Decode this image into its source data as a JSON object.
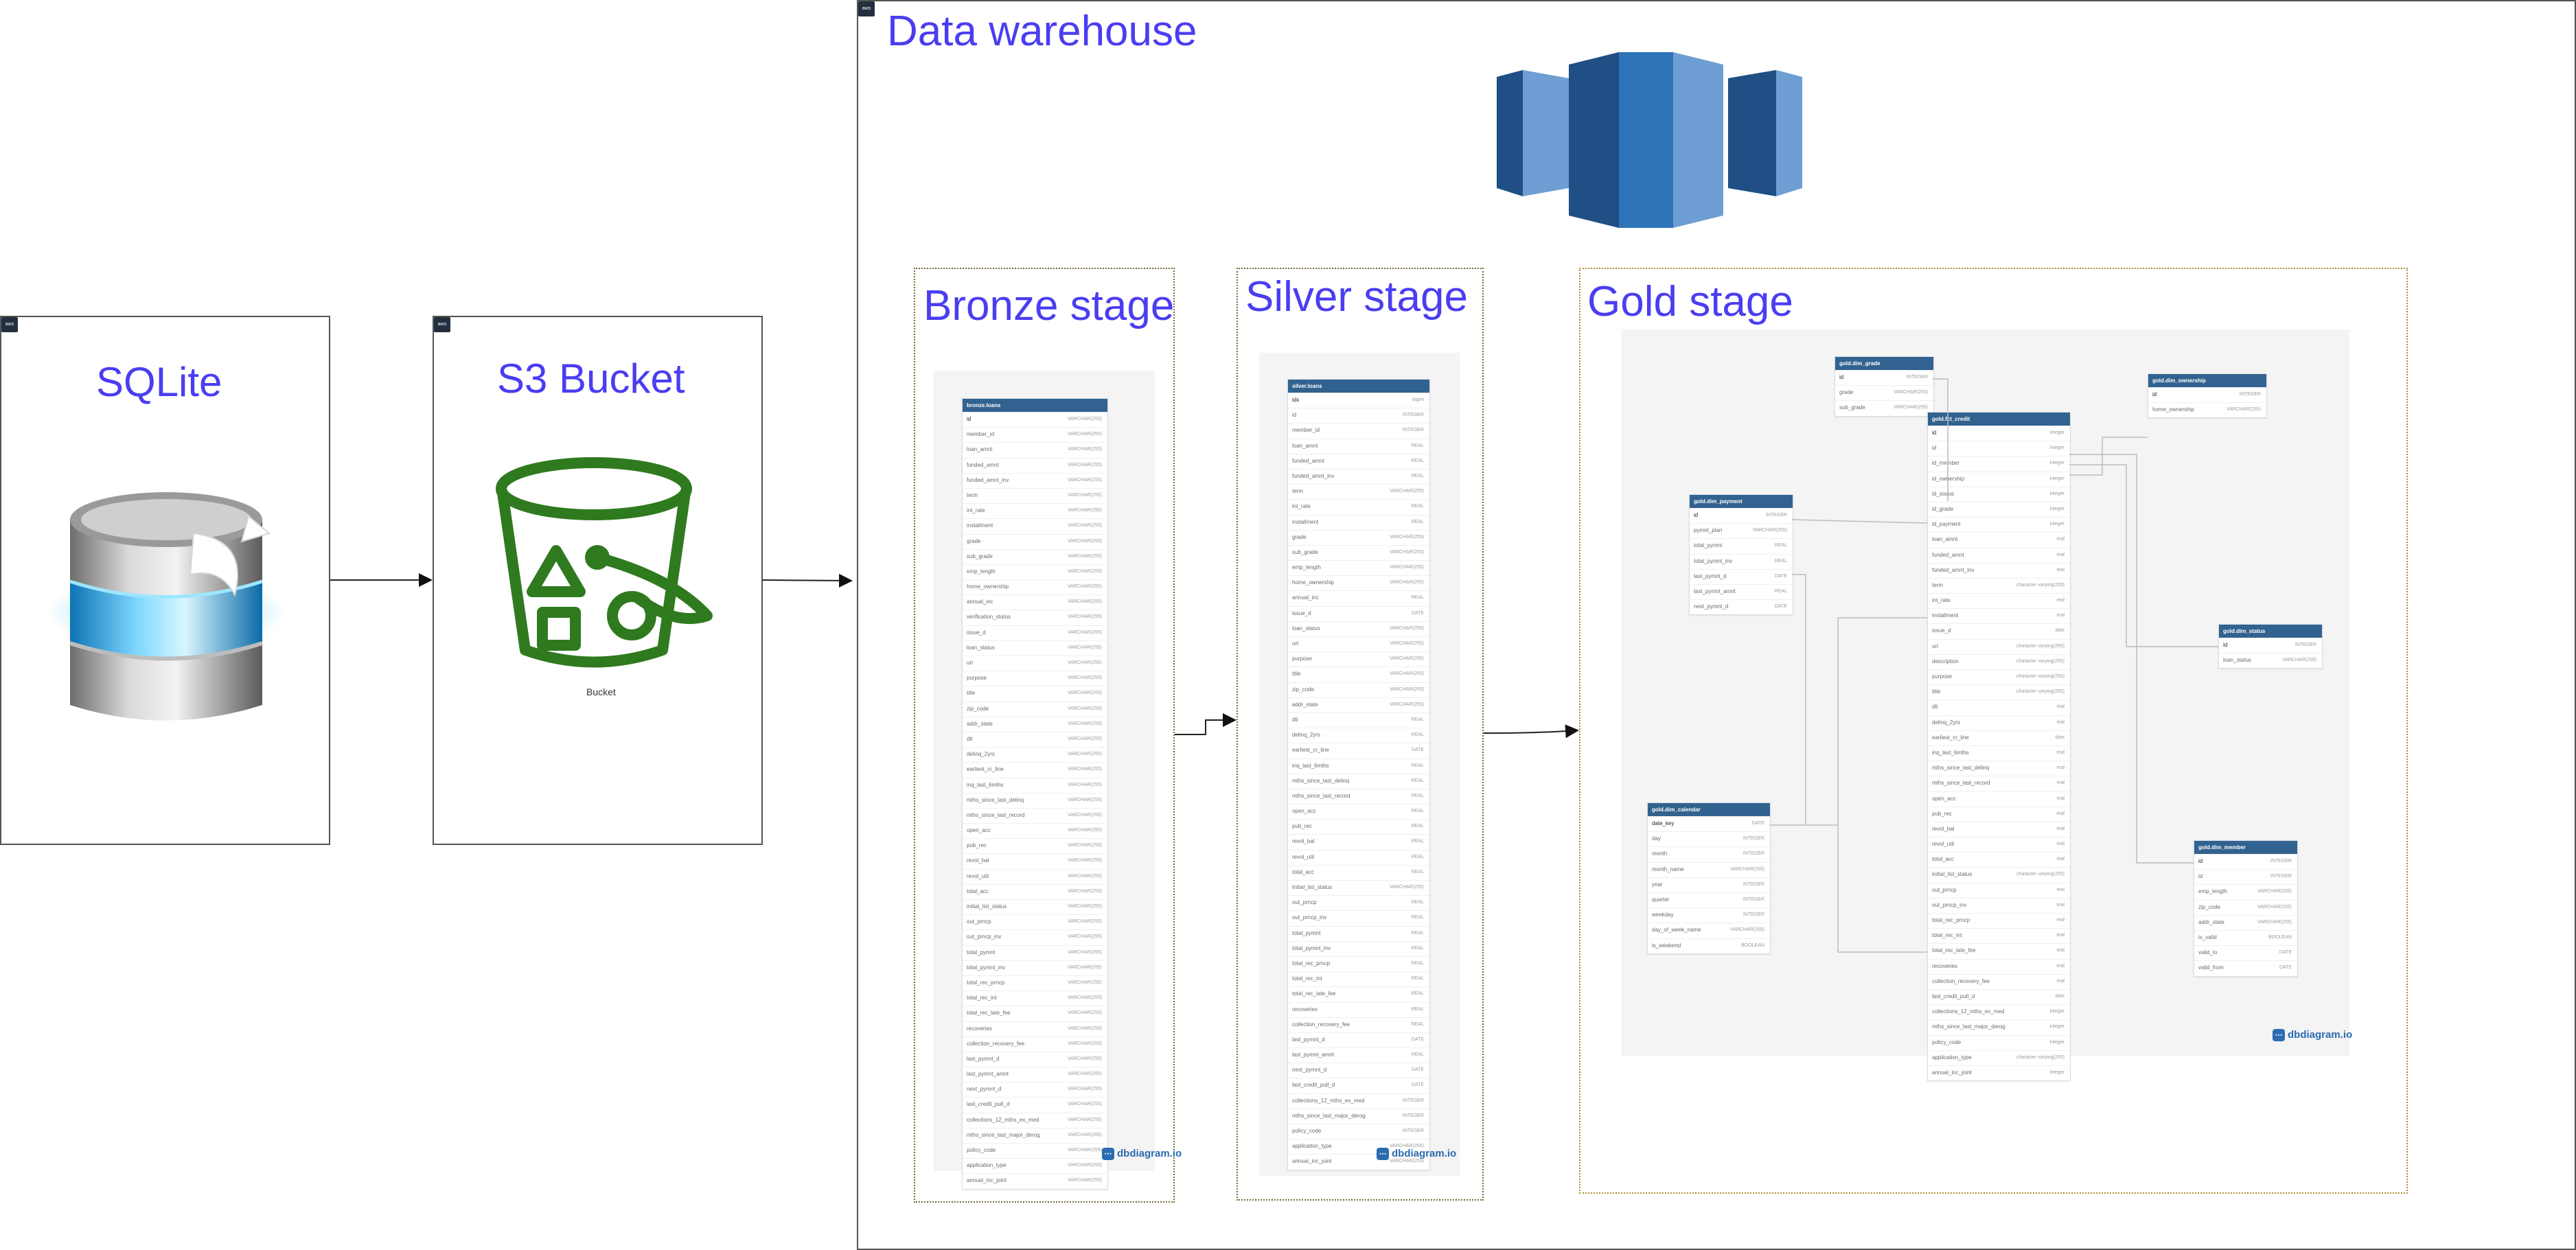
{
  "sqlite": {
    "title": "SQLite",
    "badge": "aws"
  },
  "s3": {
    "title": "S3 Bucket",
    "caption": "Bucket",
    "badge": "aws"
  },
  "warehouse": {
    "title": "Data warehouse",
    "badge": "aws"
  },
  "stages": {
    "bronze": "Bronze stage",
    "silver": "Silver stage",
    "gold": "Gold stage"
  },
  "dbdiagram_label": "dbdiagram.io",
  "icons": {
    "sqlite": "sqlite-database-icon",
    "s3": "s3-bucket-icon",
    "redshift": "amazon-redshift-icon",
    "dbdiagram": "dbdiagram-logo-icon"
  },
  "colors": {
    "title_blue": "#4a3df2",
    "bucket_green": "#2f7a1f",
    "table_header": "#32628f",
    "redshift_dark": "#1f4f84",
    "redshift_mid": "#2e73b8",
    "redshift_light": "#6e9ed3"
  },
  "bronze_table": {
    "name": "bronze.loans",
    "columns": [
      [
        "id",
        "VARCHAR(255)"
      ],
      [
        "member_id",
        "VARCHAR(255)"
      ],
      [
        "loan_amnt",
        "VARCHAR(255)"
      ],
      [
        "funded_amnt",
        "VARCHAR(255)"
      ],
      [
        "funded_amnt_inv",
        "VARCHAR(255)"
      ],
      [
        "term",
        "VARCHAR(255)"
      ],
      [
        "int_rate",
        "VARCHAR(255)"
      ],
      [
        "installment",
        "VARCHAR(255)"
      ],
      [
        "grade",
        "VARCHAR(255)"
      ],
      [
        "sub_grade",
        "VARCHAR(255)"
      ],
      [
        "emp_length",
        "VARCHAR(255)"
      ],
      [
        "home_ownership",
        "VARCHAR(255)"
      ],
      [
        "annual_inc",
        "VARCHAR(255)"
      ],
      [
        "verification_status",
        "VARCHAR(255)"
      ],
      [
        "issue_d",
        "VARCHAR(255)"
      ],
      [
        "loan_status",
        "VARCHAR(255)"
      ],
      [
        "url",
        "VARCHAR(255)"
      ],
      [
        "purpose",
        "VARCHAR(255)"
      ],
      [
        "title",
        "VARCHAR(255)"
      ],
      [
        "zip_code",
        "VARCHAR(255)"
      ],
      [
        "addr_state",
        "VARCHAR(255)"
      ],
      [
        "dti",
        "VARCHAR(255)"
      ],
      [
        "delinq_2yrs",
        "VARCHAR(255)"
      ],
      [
        "earliest_cr_line",
        "VARCHAR(255)"
      ],
      [
        "inq_last_6mths",
        "VARCHAR(255)"
      ],
      [
        "mths_since_last_delinq",
        "VARCHAR(255)"
      ],
      [
        "mths_since_last_record",
        "VARCHAR(255)"
      ],
      [
        "open_acc",
        "VARCHAR(255)"
      ],
      [
        "pub_rec",
        "VARCHAR(255)"
      ],
      [
        "revol_bal",
        "VARCHAR(255)"
      ],
      [
        "revol_util",
        "VARCHAR(255)"
      ],
      [
        "total_acc",
        "VARCHAR(255)"
      ],
      [
        "initial_list_status",
        "VARCHAR(255)"
      ],
      [
        "out_prncp",
        "VARCHAR(255)"
      ],
      [
        "out_prncp_inv",
        "VARCHAR(255)"
      ],
      [
        "total_pymnt",
        "VARCHAR(255)"
      ],
      [
        "total_pymnt_inv",
        "VARCHAR(255)"
      ],
      [
        "total_rec_prncp",
        "VARCHAR(255)"
      ],
      [
        "total_rec_int",
        "VARCHAR(255)"
      ],
      [
        "total_rec_late_fee",
        "VARCHAR(255)"
      ],
      [
        "recoveries",
        "VARCHAR(255)"
      ],
      [
        "collection_recovery_fee",
        "VARCHAR(255)"
      ],
      [
        "last_pymnt_d",
        "VARCHAR(255)"
      ],
      [
        "last_pymnt_amnt",
        "VARCHAR(255)"
      ],
      [
        "next_pymnt_d",
        "VARCHAR(255)"
      ],
      [
        "last_credit_pull_d",
        "VARCHAR(255)"
      ],
      [
        "collections_12_mths_ex_med",
        "VARCHAR(255)"
      ],
      [
        "mths_since_last_major_derog",
        "VARCHAR(255)"
      ],
      [
        "policy_code",
        "VARCHAR(255)"
      ],
      [
        "application_type",
        "VARCHAR(255)"
      ],
      [
        "annual_inc_joint",
        "VARCHAR(255)"
      ]
    ]
  },
  "silver_table": {
    "name": "silver.loans",
    "columns": [
      [
        "idx",
        "bigint"
      ],
      [
        "id",
        "INTEGER"
      ],
      [
        "member_id",
        "INTEGER"
      ],
      [
        "loan_amnt",
        "REAL"
      ],
      [
        "funded_amnt",
        "REAL"
      ],
      [
        "funded_amnt_inv",
        "REAL"
      ],
      [
        "term",
        "VARCHAR(255)"
      ],
      [
        "int_rate",
        "REAL"
      ],
      [
        "installment",
        "REAL"
      ],
      [
        "grade",
        "VARCHAR(255)"
      ],
      [
        "sub_grade",
        "VARCHAR(255)"
      ],
      [
        "emp_length",
        "VARCHAR(255)"
      ],
      [
        "home_ownership",
        "VARCHAR(255)"
      ],
      [
        "annual_inc",
        "REAL"
      ],
      [
        "issue_d",
        "DATE"
      ],
      [
        "loan_status",
        "VARCHAR(255)"
      ],
      [
        "url",
        "VARCHAR(255)"
      ],
      [
        "purpose",
        "VARCHAR(255)"
      ],
      [
        "title",
        "VARCHAR(255)"
      ],
      [
        "zip_code",
        "VARCHAR(255)"
      ],
      [
        "addr_state",
        "VARCHAR(255)"
      ],
      [
        "dti",
        "REAL"
      ],
      [
        "delinq_2yrs",
        "REAL"
      ],
      [
        "earliest_cr_line",
        "DATE"
      ],
      [
        "inq_last_6mths",
        "REAL"
      ],
      [
        "mths_since_last_delinq",
        "REAL"
      ],
      [
        "mths_since_last_record",
        "REAL"
      ],
      [
        "open_acc",
        "REAL"
      ],
      [
        "pub_rec",
        "REAL"
      ],
      [
        "revol_bal",
        "REAL"
      ],
      [
        "revol_util",
        "REAL"
      ],
      [
        "total_acc",
        "REAL"
      ],
      [
        "initial_list_status",
        "VARCHAR(255)"
      ],
      [
        "out_prncp",
        "REAL"
      ],
      [
        "out_prncp_inv",
        "REAL"
      ],
      [
        "total_pymnt",
        "REAL"
      ],
      [
        "total_pymnt_inv",
        "REAL"
      ],
      [
        "total_rec_prncp",
        "REAL"
      ],
      [
        "total_rec_int",
        "REAL"
      ],
      [
        "total_rec_late_fee",
        "REAL"
      ],
      [
        "recoveries",
        "REAL"
      ],
      [
        "collection_recovery_fee",
        "REAL"
      ],
      [
        "last_pymnt_d",
        "DATE"
      ],
      [
        "last_pymnt_amnt",
        "REAL"
      ],
      [
        "next_pymnt_d",
        "DATE"
      ],
      [
        "last_credit_pull_d",
        "DATE"
      ],
      [
        "collections_12_mths_ex_med",
        "INTEGER"
      ],
      [
        "mths_since_last_major_derog",
        "INTEGER"
      ],
      [
        "policy_code",
        "INTEGER"
      ],
      [
        "application_type",
        "VARCHAR(255)"
      ],
      [
        "annual_inc_joint",
        "VARCHAR(255)"
      ]
    ]
  },
  "gold_tables": [
    {
      "key": "grade",
      "name": "gold.dim_grade",
      "columns": [
        [
          "id",
          "INTEGER"
        ],
        [
          "grade",
          "VARCHAR(255)"
        ],
        [
          "sub_grade",
          "VARCHAR(255)"
        ]
      ]
    },
    {
      "key": "ownership",
      "name": "gold.dim_ownership",
      "columns": [
        [
          "id",
          "INTEGER"
        ],
        [
          "home_ownership",
          "VARCHAR(255)"
        ]
      ]
    },
    {
      "key": "payment",
      "name": "gold.dim_payment",
      "columns": [
        [
          "id",
          "INTEGER"
        ],
        [
          "pymnt_plan",
          "VARCHAR(255)"
        ],
        [
          "total_pymnt",
          "REAL"
        ],
        [
          "total_pymnt_inv",
          "REAL"
        ],
        [
          "last_pymnt_d",
          "DATE"
        ],
        [
          "last_pymnt_amnt",
          "REAL"
        ],
        [
          "next_pymnt_d",
          "DATE"
        ]
      ]
    },
    {
      "key": "credit",
      "name": "gold.fct_credit",
      "columns": [
        [
          "id",
          "integer"
        ],
        [
          "id",
          "integer"
        ],
        [
          "id_member",
          "integer"
        ],
        [
          "id_ownership",
          "integer"
        ],
        [
          "id_status",
          "integer"
        ],
        [
          "id_grade",
          "integer"
        ],
        [
          "id_payment",
          "integer"
        ],
        [
          "loan_amnt",
          "real"
        ],
        [
          "funded_amnt",
          "real"
        ],
        [
          "funded_amnt_inv",
          "real"
        ],
        [
          "term",
          "character varying(255)"
        ],
        [
          "int_rate",
          "real"
        ],
        [
          "installment",
          "real"
        ],
        [
          "issue_d",
          "date"
        ],
        [
          "url",
          "character varying(255)"
        ],
        [
          "description",
          "character varying(255)"
        ],
        [
          "purpose",
          "character varying(255)"
        ],
        [
          "title",
          "character varying(255)"
        ],
        [
          "dti",
          "real"
        ],
        [
          "delinq_2yrs",
          "real"
        ],
        [
          "earliest_cr_line",
          "date"
        ],
        [
          "inq_last_6mths",
          "real"
        ],
        [
          "mths_since_last_delinq",
          "real"
        ],
        [
          "mths_since_last_record",
          "real"
        ],
        [
          "open_acc",
          "real"
        ],
        [
          "pub_rec",
          "real"
        ],
        [
          "revol_bal",
          "real"
        ],
        [
          "revol_util",
          "real"
        ],
        [
          "total_acc",
          "real"
        ],
        [
          "initial_list_status",
          "character varying(255)"
        ],
        [
          "out_prncp",
          "real"
        ],
        [
          "out_prncp_inv",
          "real"
        ],
        [
          "total_rec_prncp",
          "real"
        ],
        [
          "total_rec_int",
          "real"
        ],
        [
          "total_rec_late_fee",
          "real"
        ],
        [
          "recoveries",
          "real"
        ],
        [
          "collection_recovery_fee",
          "real"
        ],
        [
          "last_credit_pull_d",
          "date"
        ],
        [
          "collections_12_mths_ex_med",
          "integer"
        ],
        [
          "mths_since_last_major_derog",
          "integer"
        ],
        [
          "policy_code",
          "integer"
        ],
        [
          "application_type",
          "character varying(255)"
        ],
        [
          "annual_inc_joint",
          "integer"
        ]
      ]
    },
    {
      "key": "status",
      "name": "gold.dim_status",
      "columns": [
        [
          "id",
          "INTEGER"
        ],
        [
          "loan_status",
          "VARCHAR(255)"
        ]
      ]
    },
    {
      "key": "calendar",
      "name": "gold.dim_calendar",
      "columns": [
        [
          "date_key",
          "DATE"
        ],
        [
          "day",
          "INTEGER"
        ],
        [
          "month",
          "INTEGER"
        ],
        [
          "month_name",
          "VARCHAR(255)"
        ],
        [
          "year",
          "INTEGER"
        ],
        [
          "quarter",
          "INTEGER"
        ],
        [
          "weekday",
          "INTEGER"
        ],
        [
          "day_of_week_name",
          "VARCHAR(255)"
        ],
        [
          "is_weekend",
          "BOOLEAN"
        ]
      ]
    },
    {
      "key": "member",
      "name": "gold.dim_member",
      "columns": [
        [
          "id",
          "INTEGER"
        ],
        [
          "id",
          "INTEGER"
        ],
        [
          "emp_length",
          "VARCHAR(255)"
        ],
        [
          "zip_code",
          "VARCHAR(255)"
        ],
        [
          "addr_state",
          "VARCHAR(255)"
        ],
        [
          "is_valid",
          "BOOLEAN"
        ],
        [
          "valid_to",
          "DATE"
        ],
        [
          "valid_from",
          "DATE"
        ]
      ]
    }
  ]
}
